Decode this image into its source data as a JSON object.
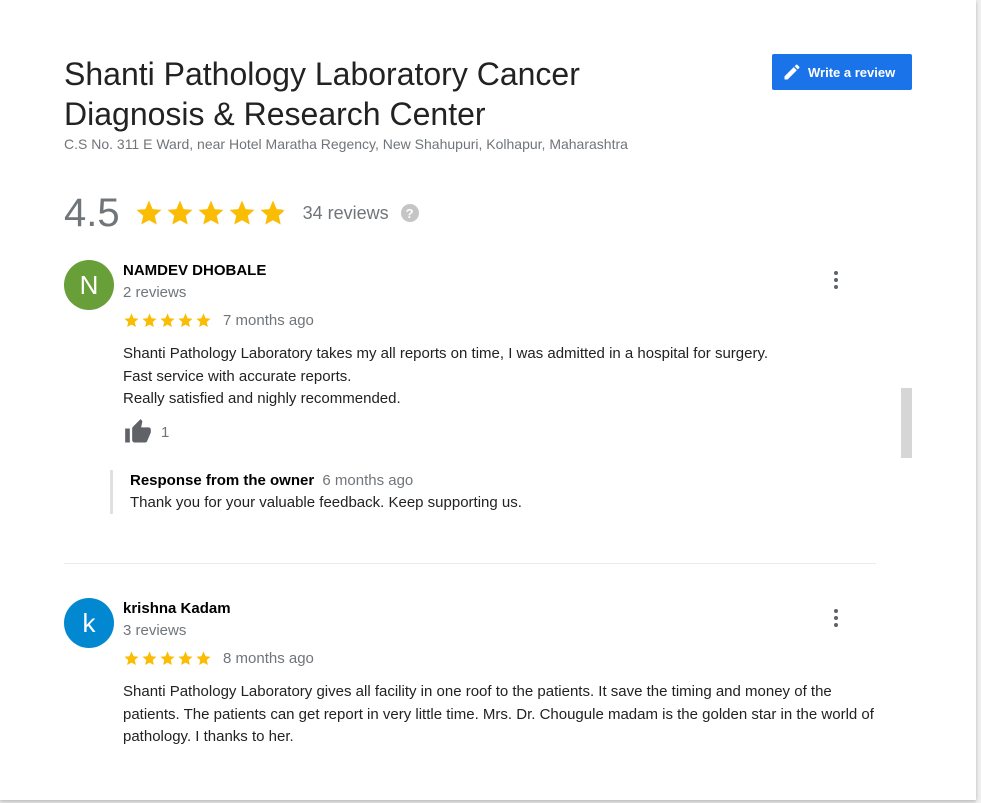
{
  "business": {
    "name": "Shanti Pathology Laboratory Cancer Diagnosis & Research Center",
    "address": "C.S No. 311 E Ward, near Hotel Maratha Regency, New Shahupuri, Kolhapur, Maharashtra"
  },
  "actions": {
    "write_review_label": "Write a review",
    "write_review_icon": "pencil-icon"
  },
  "rating": {
    "value": "4.5",
    "stars_filled_fraction": 0.9,
    "reviews_label": "34 reviews",
    "help_icon": "?"
  },
  "colors": {
    "accent": "#1a73e8",
    "star": "#fbbc04",
    "star_empty": "#dadce0"
  },
  "reviews": [
    {
      "avatar_letter": "N",
      "avatar_color": "#689f38",
      "name": "NAMDEV DHOBALE",
      "review_count": "2 reviews",
      "stars": 5,
      "time_ago": "7 months ago",
      "text_lines": [
        "Shanti Pathology Laboratory takes my all reports on time, I was admitted in a hospital for surgery.",
        "Fast service with accurate reports.",
        "Really satisfied and nighly recommended."
      ],
      "likes": "1",
      "owner_response": {
        "title": "Response from the owner",
        "time_ago": "6 months ago",
        "text": "Thank you for your valuable feedback. Keep supporting us."
      }
    },
    {
      "avatar_letter": "k",
      "avatar_color": "#0288d1",
      "name": "krishna Kadam",
      "review_count": "3 reviews",
      "stars": 5,
      "time_ago": "8 months ago",
      "text": "Shanti Pathology Laboratory gives all facility in one roof to the patients. It save the timing and money of the patients. The patients can get report in very little time. Mrs. Dr. Chougule madam is the golden star in the world of pathology. I thanks to her."
    }
  ]
}
